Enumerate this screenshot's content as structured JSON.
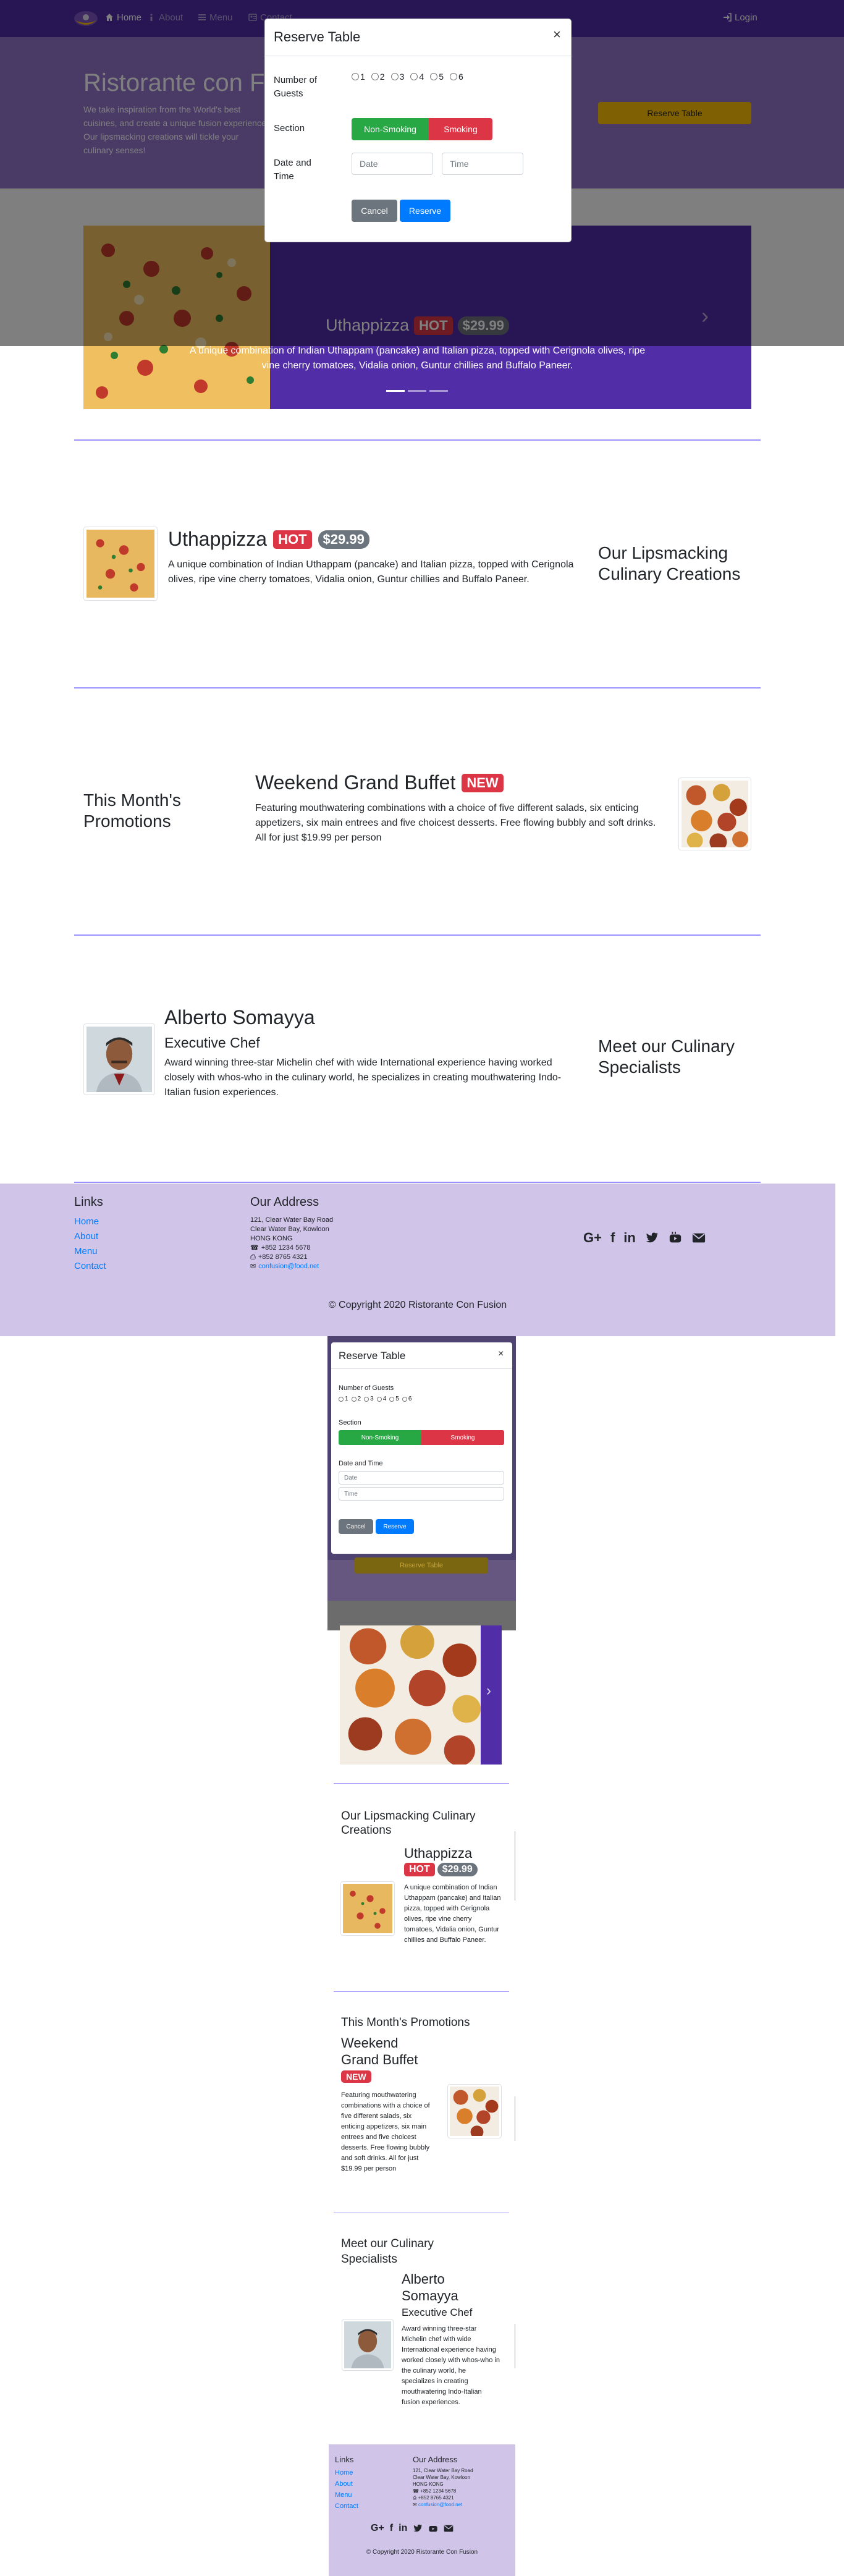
{
  "nav": {
    "items": [
      {
        "label": "Home",
        "icon": "home-icon"
      },
      {
        "label": "About",
        "icon": "info-icon"
      },
      {
        "label": "Menu",
        "icon": "list-icon"
      },
      {
        "label": "Contact",
        "icon": "address-card-icon"
      }
    ],
    "login": "Login"
  },
  "jumbotron": {
    "title": "Ristorante con Fusion",
    "text": "We take inspiration from the World's best cuisines, and create a unique fusion experience. Our lipsmacking creations will tickle your culinary senses!",
    "button": "Reserve Table"
  },
  "modal": {
    "title": "Reserve Table",
    "close": "×",
    "guests_label": "Number of Guests",
    "guests": [
      "1",
      "2",
      "3",
      "4",
      "5",
      "6"
    ],
    "section_label": "Section",
    "non_smoking": "Non-Smoking",
    "smoking": "Smoking",
    "datetime_label": "Date and Time",
    "date_placeholder": "Date",
    "time_placeholder": "Time",
    "cancel": "Cancel",
    "reserve": "Reserve"
  },
  "carousel": {
    "title": "Uthappizza",
    "badge": "HOT",
    "price": "$29.99",
    "description": "A unique combination of Indian Uthappam (pancake) and Italian pizza, topped with Cerignola olives, ripe vine cherry tomatoes, Vidalia onion, Guntur chillies and Buffalo Paneer."
  },
  "dish": {
    "heading": "Our Lipsmacking Culinary Creations",
    "title": "Uthappizza",
    "badge": "HOT",
    "price": "$29.99",
    "description": "A unique combination of Indian Uthappam (pancake) and Italian pizza, topped with Cerignola olives, ripe vine cherry tomatoes, Vidalia onion, Guntur chillies and Buffalo Paneer."
  },
  "promotion": {
    "heading": "This Month's Promotions",
    "title": "Weekend Grand Buffet",
    "badge": "NEW",
    "description": "Featuring mouthwatering combinations with a choice of five different salads, six enticing appetizers, six main entrees and five choicest desserts. Free flowing bubbly and soft drinks. All for just $19.99 per person"
  },
  "leader": {
    "heading": "Meet our Culinary Specialists",
    "name": "Alberto Somayya",
    "role": "Executive Chef",
    "description": "Award winning three-star Michelin chef with wide International experience having worked closely with whos-who in the culinary world, he specializes in creating mouthwatering Indo-Italian fusion experiences."
  },
  "footer": {
    "links_heading": "Links",
    "links": [
      "Home",
      "About",
      "Menu",
      "Contact"
    ],
    "address_heading": "Our Address",
    "address": [
      "121, Clear Water Bay Road",
      "Clear Water Bay, Kowloon",
      "HONG KONG"
    ],
    "phone": "+852 1234 5678",
    "fax": "+852 8765 4321",
    "email": "confusion@food.net",
    "social": [
      "G+",
      "f",
      "in",
      "t",
      "yt",
      "mail"
    ],
    "copyright": "© Copyright 2020 Ristorante Con Fusion"
  },
  "colors": {
    "primary": "#512da8",
    "jumbotron": "#9575cd",
    "footer": "#d1c4e9",
    "warning": "#ffc107",
    "success": "#28a745",
    "danger": "#dc3545"
  }
}
